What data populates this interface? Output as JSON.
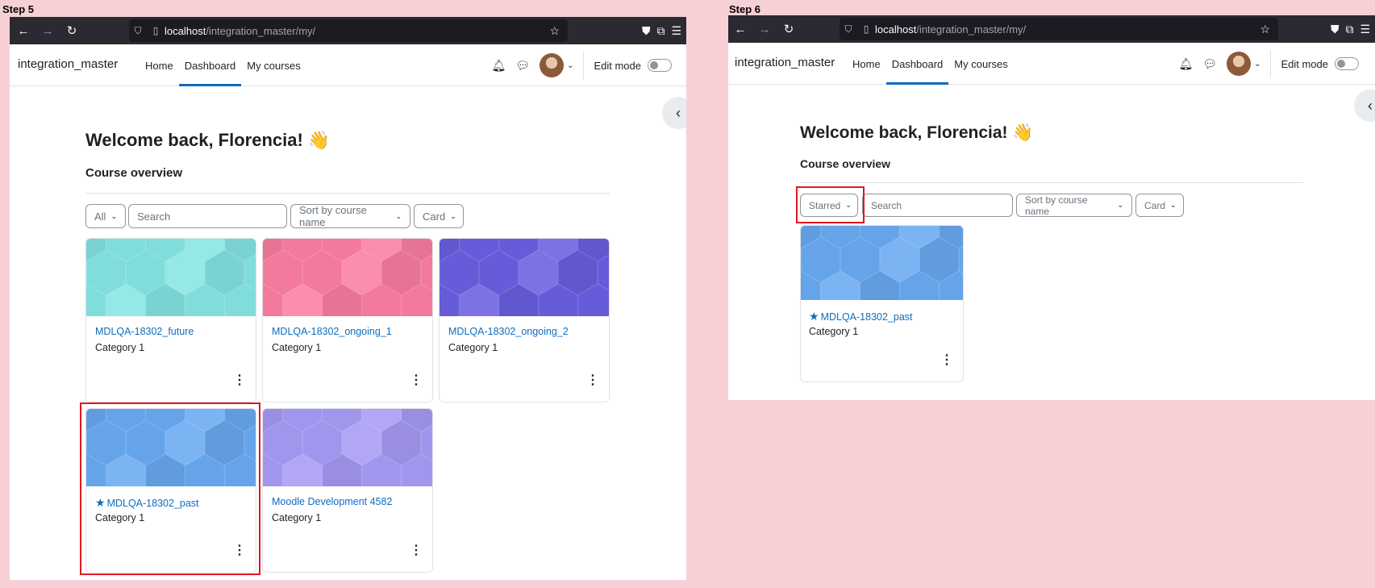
{
  "steps": [
    "Step 5",
    "Step 6"
  ],
  "browser": {
    "url_host": "localhost",
    "url_path": "/integration_master/my/"
  },
  "site": {
    "brand": "integration_master",
    "nav": [
      "Home",
      "Dashboard",
      "My courses"
    ],
    "active_nav": "Dashboard",
    "edit_mode_label": "Edit mode"
  },
  "dashboard": {
    "welcome": "Welcome back, Florencia! 👋",
    "section_title": "Course overview",
    "search_placeholder": "Search",
    "sort_label": "Sort by course name",
    "view_label": "Card"
  },
  "step5": {
    "filter_label": "All",
    "courses": [
      {
        "name": "MDLQA-18302_future",
        "category": "Category 1",
        "starred": false,
        "color": "#86e5e3"
      },
      {
        "name": "MDLQA-18302_ongoing_1",
        "category": "Category 1",
        "starred": false,
        "color": "#fb7ea2"
      },
      {
        "name": "MDLQA-18302_ongoing_2",
        "category": "Category 1",
        "starred": false,
        "color": "#6a5fe0"
      },
      {
        "name": "MDLQA-18302_past",
        "category": "Category 1",
        "starred": true,
        "color": "#6aaaf2"
      },
      {
        "name": "Moodle Development 4582",
        "category": "Category 1",
        "starred": false,
        "color": "#a79bf5"
      }
    ]
  },
  "step6": {
    "filter_label": "Starred",
    "courses": [
      {
        "name": "MDLQA-18302_past",
        "category": "Category 1",
        "starred": true,
        "color": "#6aaaf2"
      }
    ]
  },
  "colors": {
    "highlight": "#e0181f",
    "link": "#0f6cbf",
    "page_bg": "#f7d0d6",
    "browser_chrome": "#2b2a33"
  }
}
